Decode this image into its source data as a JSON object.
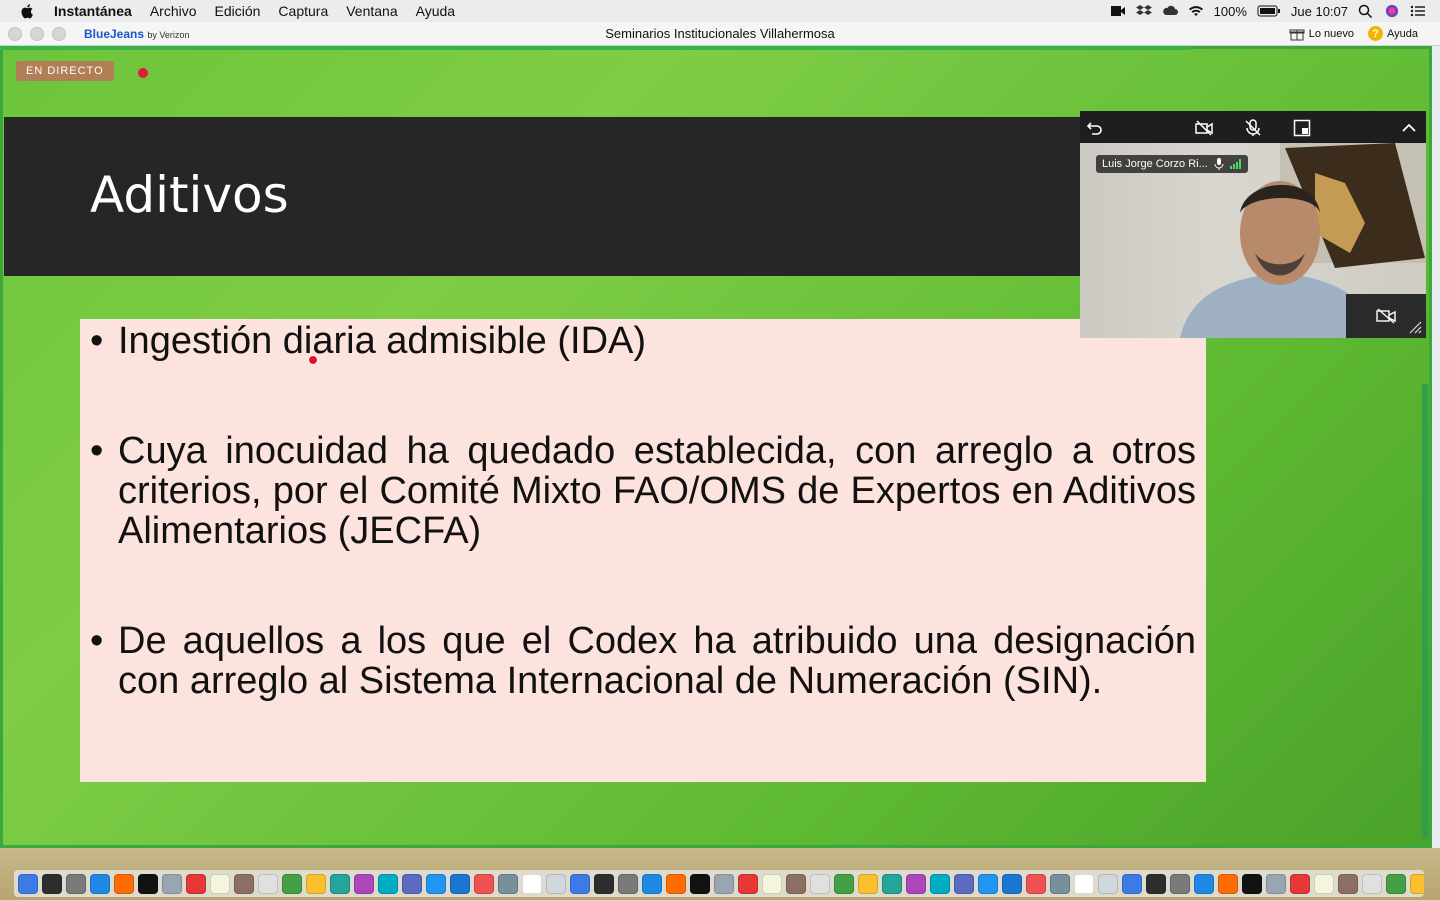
{
  "menubar": {
    "app_name": "Instantánea",
    "items": [
      "Archivo",
      "Edición",
      "Captura",
      "Ventana",
      "Ayuda"
    ],
    "battery": "100%",
    "clock": "Jue 10:07"
  },
  "window": {
    "brand": "BlueJeans",
    "brand_sub": "by Verizon",
    "title": "Seminarios Institucionales Villahermosa",
    "whats_new": "Lo nuevo",
    "help": "Ayuda"
  },
  "live": {
    "label": "EN DIRECTO"
  },
  "slide": {
    "title": "Aditivos",
    "bullets": [
      "Ingestión diaria admisible (IDA)",
      "Cuya inocuidad ha quedado establecida, con arreglo a otros criterios, por el Comité Mixto FAO/OMS de Expertos en Aditivos Alimentarios (JECFA)",
      "De aquellos a los que el Codex ha atribuido una designación con arreglo al Sistema Internacional de Numeración (SIN)."
    ]
  },
  "video": {
    "participant_name": "Luis Jorge Corzo Ri..."
  },
  "colors": {
    "stage_green": "#6dc43b",
    "slide_band": "#262626",
    "content_bg": "#fde3dd",
    "live_badge": "#b07f55",
    "live_dot": "#e5193b",
    "brand_blue": "#1a55c9"
  }
}
